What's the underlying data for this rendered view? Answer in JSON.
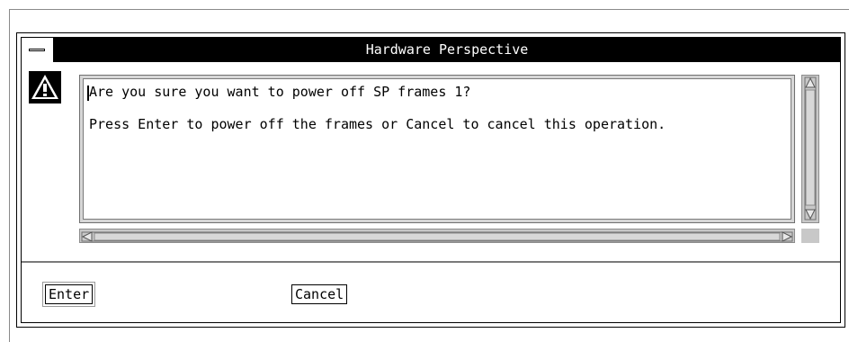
{
  "window": {
    "title": "Hardware Perspective"
  },
  "message": {
    "line1": "Are you sure you want to power off SP frames 1?",
    "line2": "Press Enter to power off the frames or Cancel to cancel this operation."
  },
  "buttons": {
    "enter_label": "Enter",
    "cancel_label": "Cancel"
  },
  "icons": {
    "warning": "warning-icon",
    "window_menu": "window-menu-icon"
  },
  "colors": {
    "titlebar_bg": "#000000",
    "titlebar_text": "#ffffff",
    "scrollbar": "#c8c8c8"
  }
}
